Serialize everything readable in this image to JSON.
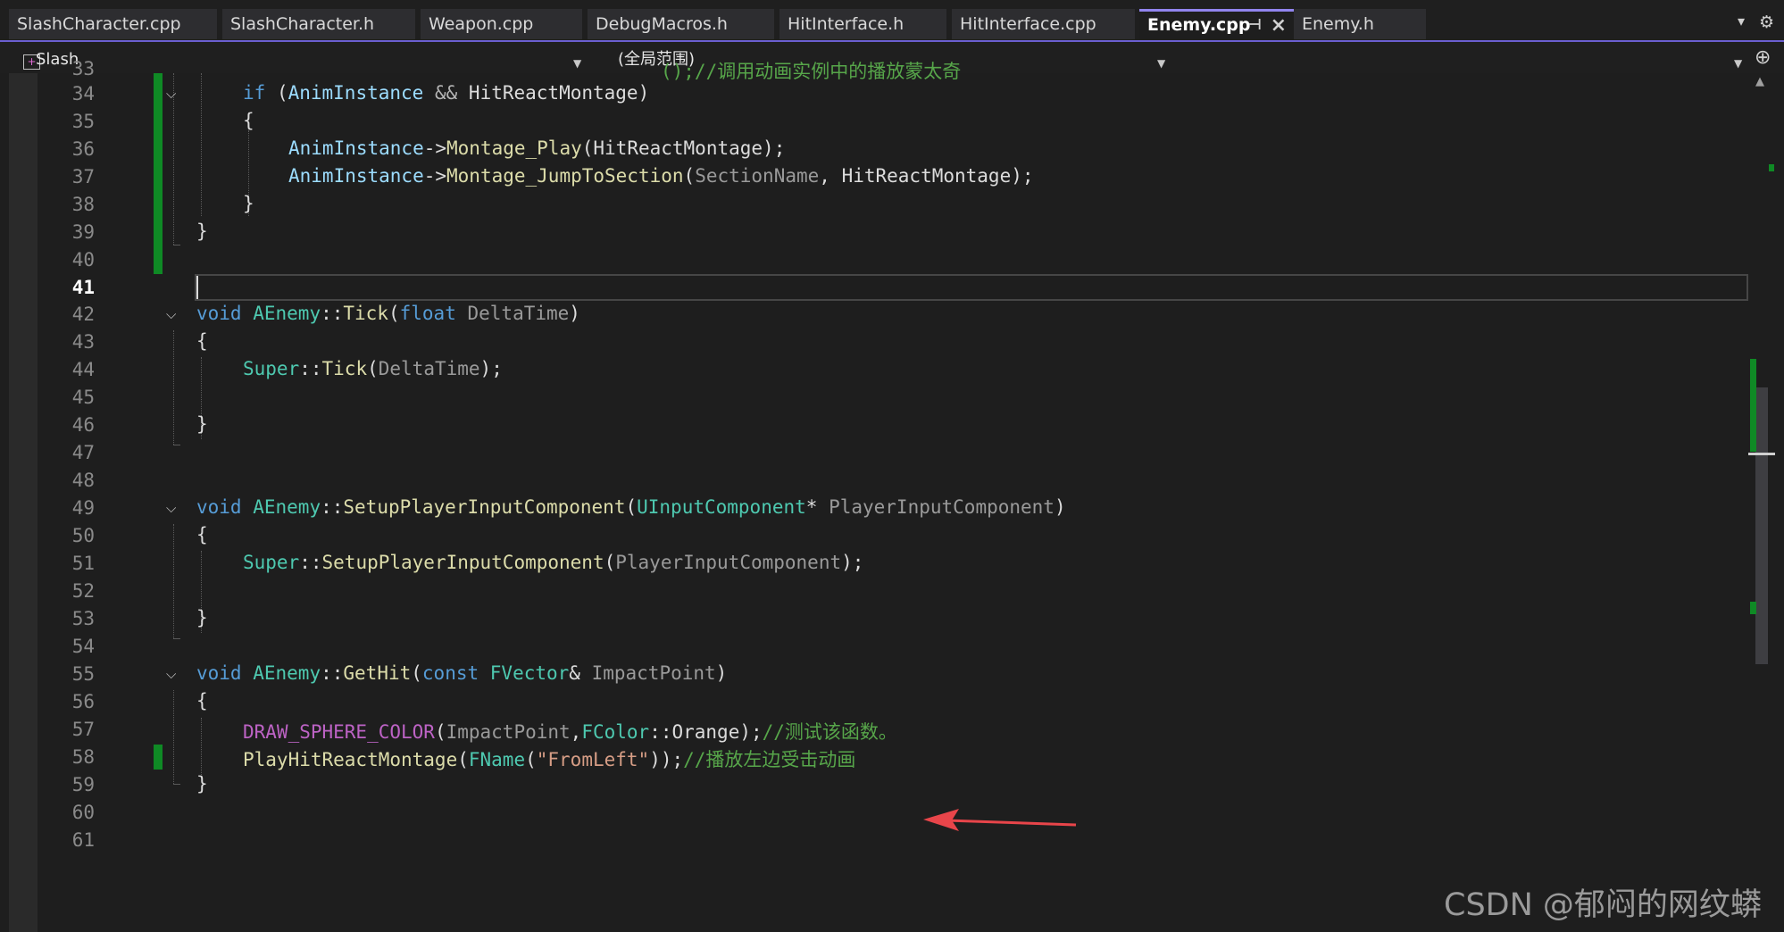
{
  "tabs": [
    {
      "label": "SlashCharacter.cpp",
      "active": false
    },
    {
      "label": "SlashCharacter.h",
      "active": false
    },
    {
      "label": "Weapon.cpp",
      "active": false
    },
    {
      "label": "DebugMacros.h",
      "active": false
    },
    {
      "label": "HitInterface.h",
      "active": false
    },
    {
      "label": "HitInterface.cpp",
      "active": false
    },
    {
      "label": "Enemy.cpp",
      "active": true
    },
    {
      "label": "Enemy.h",
      "active": false
    }
  ],
  "navbar": {
    "project": "Slash",
    "scope": "(全局范围)",
    "member": ""
  },
  "editor": {
    "current_line": 41,
    "line_numbers": [
      "33",
      "34",
      "35",
      "36",
      "37",
      "38",
      "39",
      "40",
      "41",
      "42",
      "43",
      "44",
      "45",
      "46",
      "47",
      "48",
      "49",
      "50",
      "51",
      "52",
      "53",
      "54",
      "55",
      "56",
      "57",
      "58",
      "59",
      "60",
      "61"
    ],
    "code": {
      "l33": "();//调用动画实例中的播放蒙太奇",
      "l34_if": "if",
      "l34_a": "AnimInstance",
      "l34_op": "&&",
      "l34_b": "HitReactMontage",
      "l35": "{",
      "l36_obj": "AnimInstance",
      "l36_fn": "Montage_Play",
      "l36_arg": "HitReactMontage",
      "l37_obj": "AnimInstance",
      "l37_fn": "Montage_JumpToSection",
      "l37_arg1": "SectionName",
      "l37_arg2": "HitReactMontage",
      "l38": "}",
      "l39": "}",
      "l42_void": "void",
      "l42_cls": "AEnemy",
      "l42_fn": "Tick",
      "l42_type": "float",
      "l42_param": "DeltaTime",
      "l43": "{",
      "l44_super": "Super",
      "l44_fn": "Tick",
      "l44_arg": "DeltaTime",
      "l46": "}",
      "l49_void": "void",
      "l49_cls": "AEnemy",
      "l49_fn": "SetupPlayerInputComponent",
      "l49_type": "UInputComponent",
      "l49_param": "PlayerInputComponent",
      "l50": "{",
      "l51_super": "Super",
      "l51_fn": "SetupPlayerInputComponent",
      "l51_arg": "PlayerInputComponent",
      "l53": "}",
      "l55_void": "void",
      "l55_cls": "AEnemy",
      "l55_fn": "GetHit",
      "l55_const": "const",
      "l55_type": "FVector",
      "l55_param": "ImpactPoint",
      "l56": "{",
      "l57_macro": "DRAW_SPHERE_COLOR",
      "l57_arg1": "ImpactPoint",
      "l57_type": "FColor",
      "l57_member": "Orange",
      "l57_comment": "//测试该函数。",
      "l58_fn": "PlayHitReactMontage",
      "l58_type": "FName",
      "l58_str": "\"FromLeft\"",
      "l58_comment": "//播放左边受击动画",
      "l59": "}"
    }
  },
  "colors": {
    "accent": "#9184ee",
    "change_marker": "#0f8a25",
    "annotation_arrow": "#e8454a"
  },
  "icons": [
    "tab-pin-icon",
    "tab-close-icon",
    "tab-overflow-icon",
    "settings-gear-icon",
    "project-icon",
    "split-editor-icon",
    "fold-chevron-icon"
  ],
  "watermark": "CSDN @郁闷的网纹蟒"
}
